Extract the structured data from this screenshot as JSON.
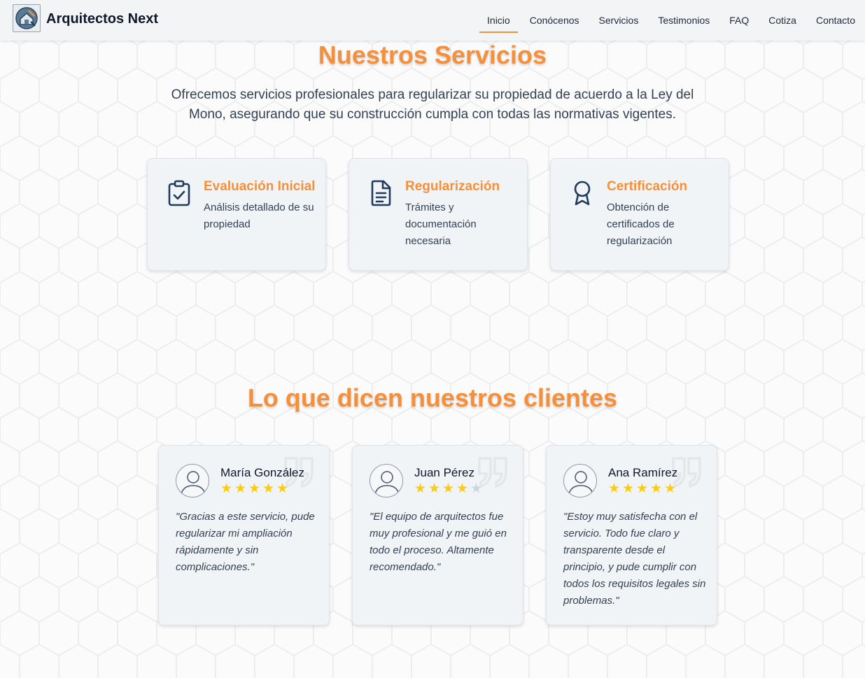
{
  "brand": {
    "name": "Arquitectos Next",
    "logo_icon": "house-blueprint-logo"
  },
  "nav": {
    "items": [
      {
        "label": "Inicio",
        "active": true
      },
      {
        "label": "Conócenos"
      },
      {
        "label": "Servicios"
      },
      {
        "label": "Testimonios"
      },
      {
        "label": "FAQ"
      },
      {
        "label": "Cotiza"
      },
      {
        "label": "Contacto"
      }
    ]
  },
  "services": {
    "title": "Nuestros Servicios",
    "intro": "Ofrecemos servicios profesionales para regularizar su propiedad de acuerdo a la Ley del Mono, asegurando que su construcción cumpla con todas las normativas vigentes.",
    "cards": [
      {
        "icon": "clipboard-check-icon",
        "title": "Evaluación Inicial",
        "description": "Análisis detallado de su propiedad"
      },
      {
        "icon": "document-icon",
        "title": "Regularización",
        "description": "Trámites y documentación necesaria"
      },
      {
        "icon": "award-icon",
        "title": "Certificación",
        "description": "Obtención de certificados de regularización"
      }
    ]
  },
  "testimonials": {
    "title": "Lo que dicen nuestros clientes",
    "items": [
      {
        "name": "María González",
        "rating": 5,
        "quote": "\"Gracias a este servicio, pude regularizar mi ampliación rápidamente y sin complicaciones.\""
      },
      {
        "name": "Juan Pérez",
        "rating": 4,
        "quote": "\"El equipo de arquitectos fue muy profesional y me guió en todo el proceso. Altamente recomendado.\""
      },
      {
        "name": "Ana Ramírez",
        "rating": 5,
        "quote": "\"Estoy muy satisfecha con el servicio. Todo fue claro y transparente desde el principio, y pude cumplir con todos los requisitos legales sin problemas.\""
      }
    ]
  },
  "colors": {
    "accent": "#f4903b",
    "star": "#facc15",
    "star_off": "#cbd5e1",
    "text": "#334155"
  }
}
